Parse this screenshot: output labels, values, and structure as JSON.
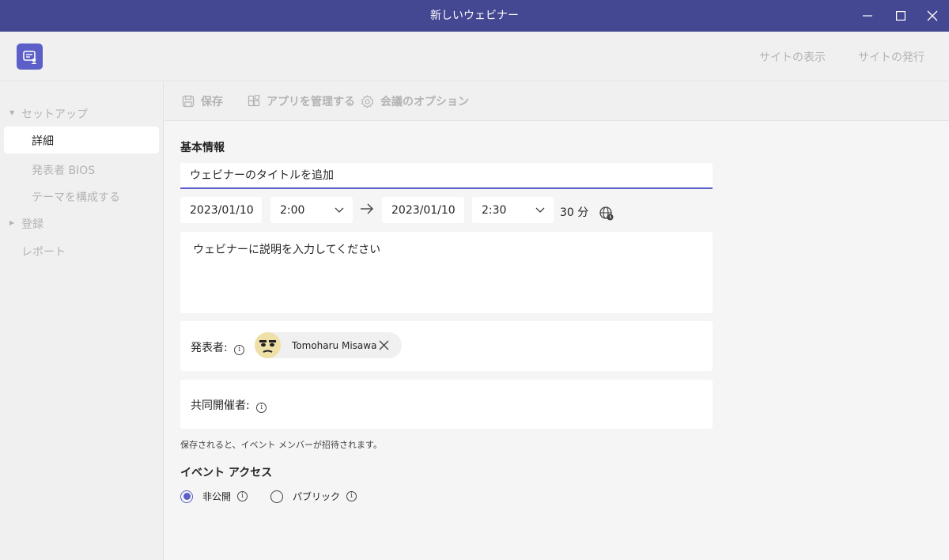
{
  "window": {
    "title": "新しいウェビナー",
    "minimize_icon": "minimize-icon",
    "maximize_icon": "maximize-icon",
    "close_icon": "close-icon"
  },
  "appbar": {
    "logo_icon": "webinar-app-icon",
    "view_site": "サイトの表示",
    "publish_site": "サイトの発行"
  },
  "sidebar": {
    "setup_group": "セットアップ",
    "items": [
      {
        "label": "詳細",
        "selected": true
      },
      {
        "label": "発表者 BIOS",
        "selected": false
      },
      {
        "label": "テーマを構成する",
        "selected": false
      }
    ],
    "registration_group": "登録",
    "report": "レポート"
  },
  "toolbar": {
    "save": "保存",
    "manage_apps": "アプリを管理する",
    "meeting_options": "会議のオプション"
  },
  "form": {
    "basic_info_heading": "基本情報",
    "title_placeholder": "ウェビナーのタイトルを追加",
    "start_date": "2023/01/10",
    "start_time": "2:00",
    "end_date": "2023/01/10",
    "end_time": "2:30",
    "duration": "30 分",
    "description_placeholder": "ウェビナーに説明を入力してください",
    "presenter_label": "発表者:",
    "presenter_name": "Tomoharu Misawa",
    "coorganizer_label": "共同開催者:",
    "invite_note": "保存されると、イベント メンバーが招待されます。",
    "access_heading": "イベント アクセス",
    "access_options": [
      {
        "label": "非公開",
        "selected": true
      },
      {
        "label": "パブリック",
        "selected": false
      }
    ]
  },
  "colors": {
    "titlebar": "#444791",
    "accent": "#5b5fc7",
    "muted": "#b3b3b3"
  }
}
